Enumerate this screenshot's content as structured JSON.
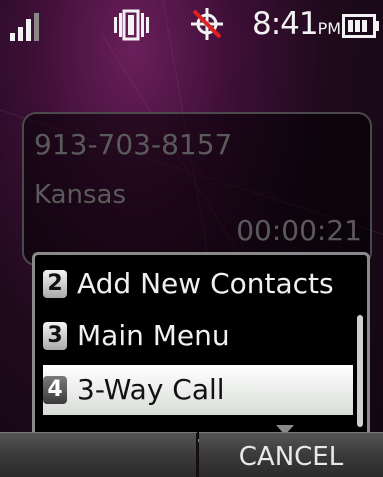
{
  "status_bar": {
    "time": "8:41",
    "time_suffix": "PM",
    "icons": [
      "signal-icon",
      "vibrate-icon",
      "gps-icon",
      "battery-icon"
    ]
  },
  "call": {
    "number": "913-703-8157",
    "location": "Kansas",
    "duration": "00:00:21"
  },
  "menu": {
    "items": [
      {
        "number": "2",
        "label": "Add New Contacts"
      },
      {
        "number": "3",
        "label": "Main Menu"
      },
      {
        "number": "4",
        "label": "3-Way Call",
        "selected": true
      }
    ]
  },
  "softkeys": {
    "left": "",
    "right": "CANCEL"
  },
  "colors": {
    "wallpaper": "#3e0f37",
    "selected_bg": "#eceeec",
    "card_text": "#5a5a5a"
  }
}
